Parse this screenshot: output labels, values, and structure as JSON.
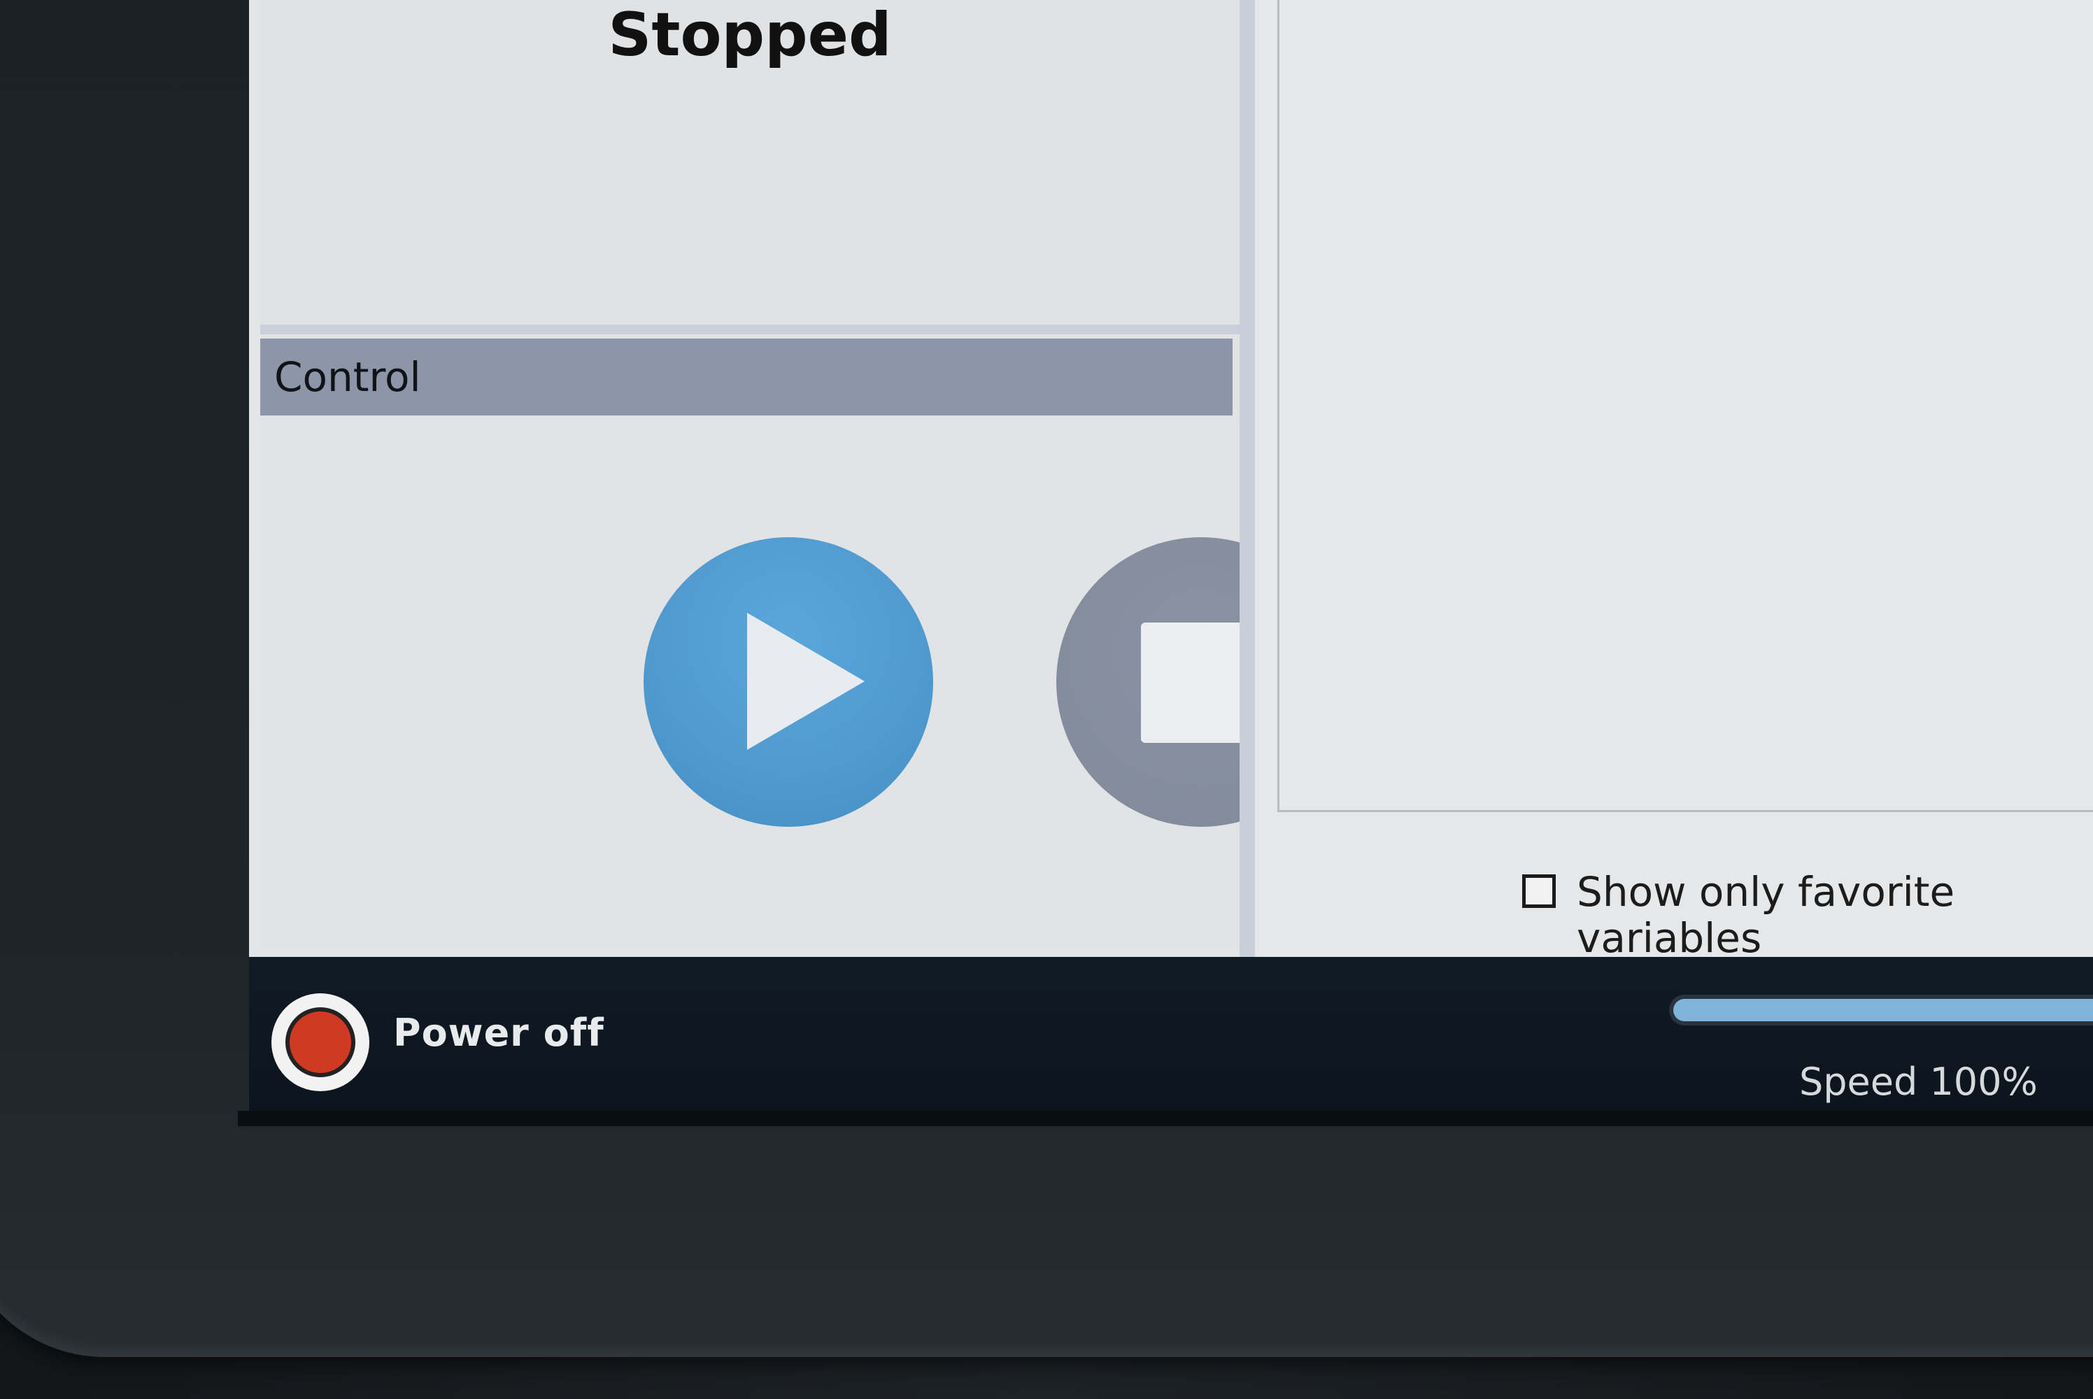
{
  "status": {
    "text": "Stopped"
  },
  "control": {
    "title": "Control"
  },
  "variables": {
    "favorites_checkbox_label": "Show only favorite variables",
    "favorites_checked": false
  },
  "footer": {
    "power_label": "Power off",
    "power_color": "#d13a22",
    "speed_label": "Speed 100%",
    "speed_fraction": 1.0
  },
  "colors": {
    "play_button": "#4f99cf",
    "stop_button": "#818a9b",
    "control_header": "#8d96a8",
    "footer_bg": "#0f1821"
  },
  "icons": {
    "play": "play-icon",
    "stop": "stop-icon",
    "power": "power-indicator-icon"
  }
}
